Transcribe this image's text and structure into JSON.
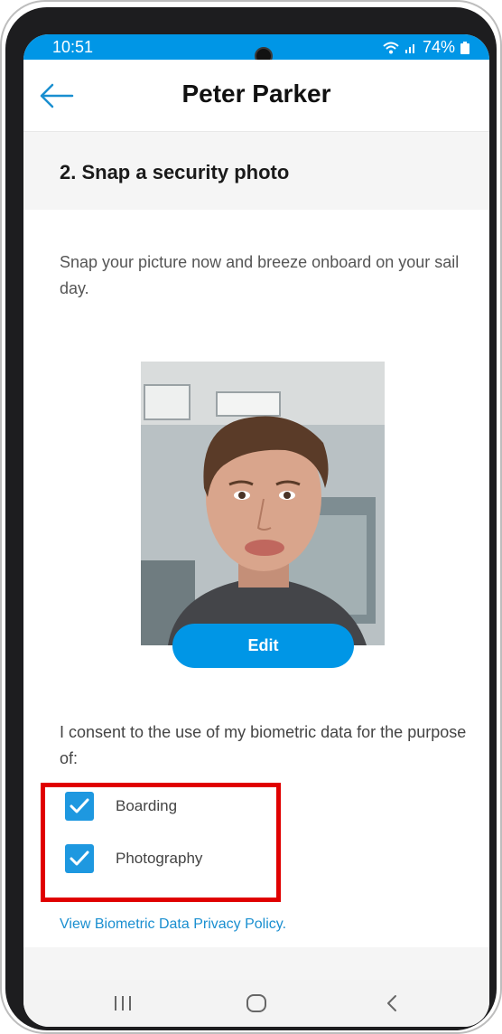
{
  "status_bar": {
    "time": "10:51",
    "battery": "74%",
    "wifi_icon": "wifi-icon",
    "signal_icon": "signal-icon",
    "battery_icon": "battery-icon"
  },
  "header": {
    "title": "Peter Parker",
    "back_icon": "arrow-left-icon"
  },
  "section": {
    "title": "2. Snap a security photo"
  },
  "intro_text": "Snap your picture now and breeze onboard on your sail day.",
  "photo": {
    "edit_label": "Edit"
  },
  "consent": {
    "text": "I consent to the use of my biometric data for the purpose of:",
    "options": [
      {
        "label": "Boarding",
        "checked": true
      },
      {
        "label": "Photography",
        "checked": true
      }
    ]
  },
  "policy_link": "View Biometric Data Privacy Policy.",
  "colors": {
    "accent": "#0096e6",
    "highlight": "#e00000"
  }
}
